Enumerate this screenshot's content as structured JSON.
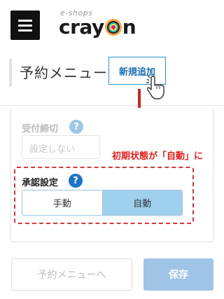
{
  "header": {
    "logo_small": "e-shops",
    "logo_prefix": "cray",
    "logo_suffix": "n"
  },
  "section": {
    "title": "予約メニュー",
    "new_button": "新規追加"
  },
  "form": {
    "deadline": {
      "label": "受付締切",
      "placeholder": "設定しない"
    },
    "approval": {
      "label": "承認設定",
      "options": [
        "手動",
        "自動"
      ],
      "selected": "自動"
    }
  },
  "annotation": "初期状態が「自動」に",
  "footer": {
    "back_button": "予約メニューへ",
    "save_button": "保存"
  },
  "colors": {
    "accent": "#2b8ed8",
    "annotation_red": "#e02020",
    "selected_option": "#9fd0ee",
    "save_disabled": "#9fc4e6"
  }
}
